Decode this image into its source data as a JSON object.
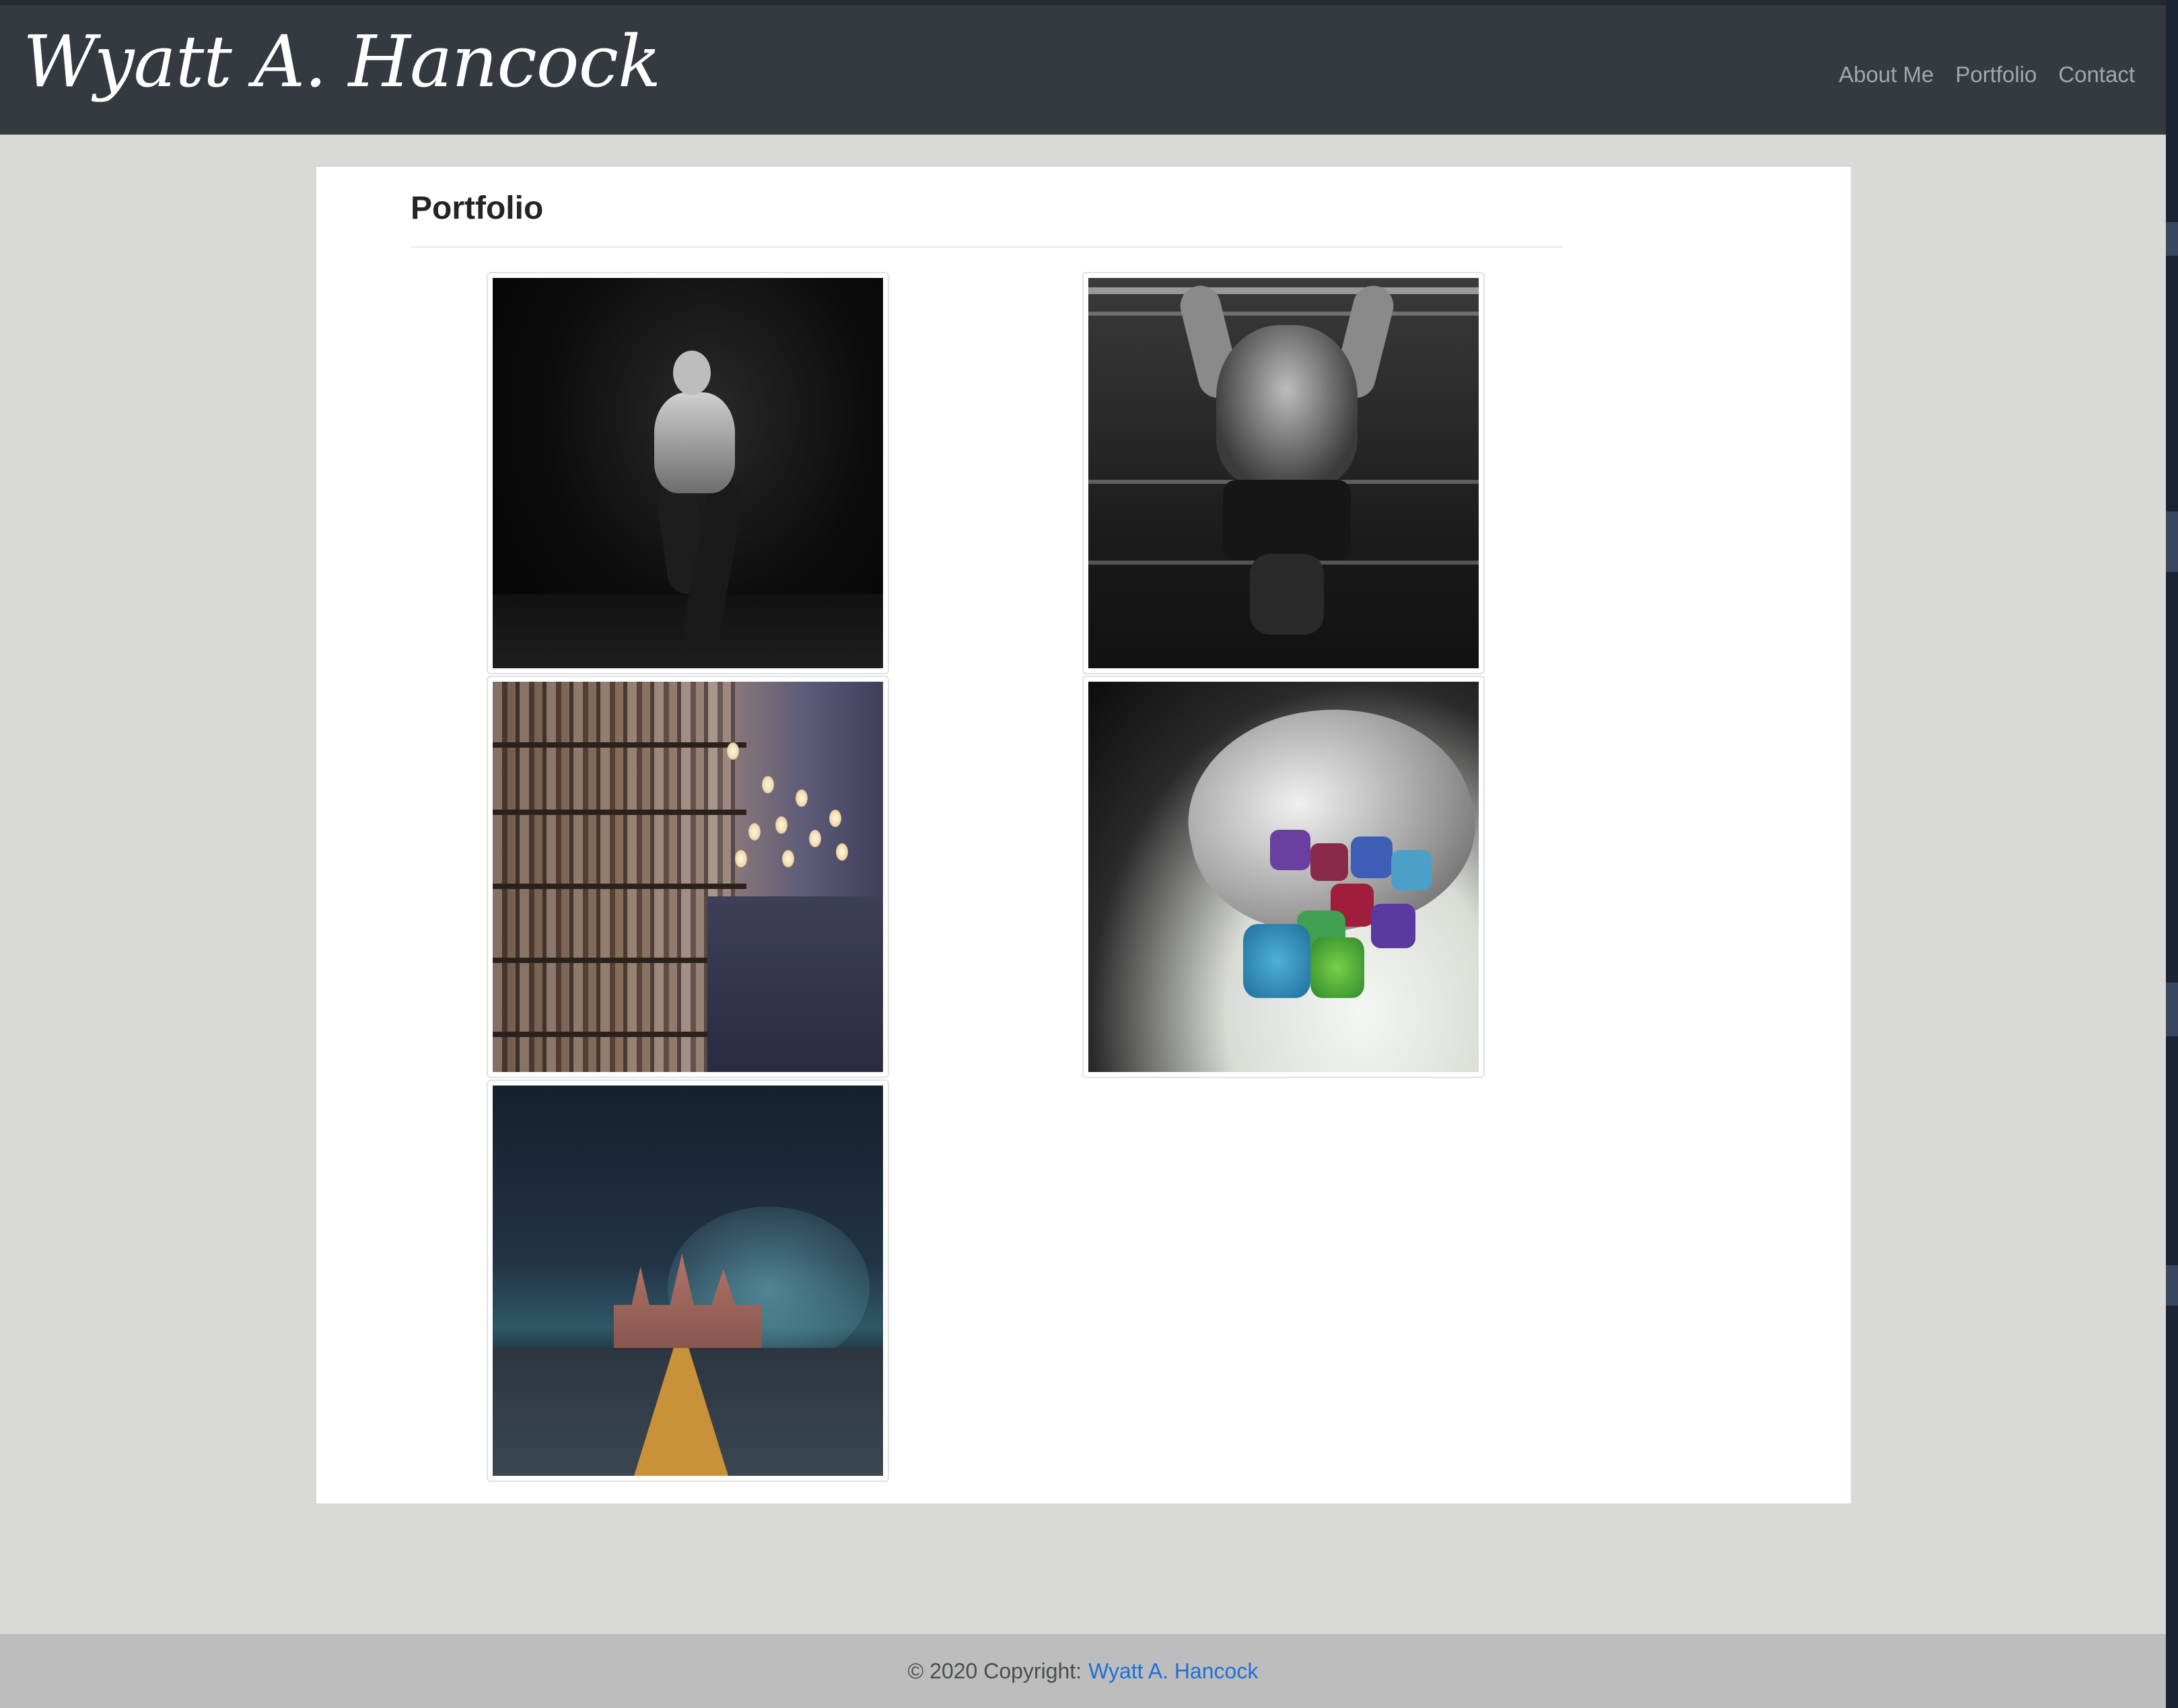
{
  "header": {
    "brand": "Wyatt A. Hancock",
    "nav": [
      {
        "label": "About Me"
      },
      {
        "label": "Portfolio"
      },
      {
        "label": "Contact"
      }
    ]
  },
  "main": {
    "title": "Portfolio",
    "gallery": [
      {
        "subject": "fighter-kick-photo"
      },
      {
        "subject": "pull-up-gym-photo"
      },
      {
        "subject": "library-bookshelves-photo"
      },
      {
        "subject": "dice-bag-photo"
      },
      {
        "subject": "st-basils-cathedral-night-photo"
      }
    ]
  },
  "footer": {
    "copyright": "© 2020 Copyright:",
    "link": "Wyatt A. Hancock"
  },
  "colors": {
    "navbar": "#343a40",
    "page_bg": "#d9dad6",
    "footer_bg": "#bcbdbc",
    "link": "#1f6fd8"
  }
}
